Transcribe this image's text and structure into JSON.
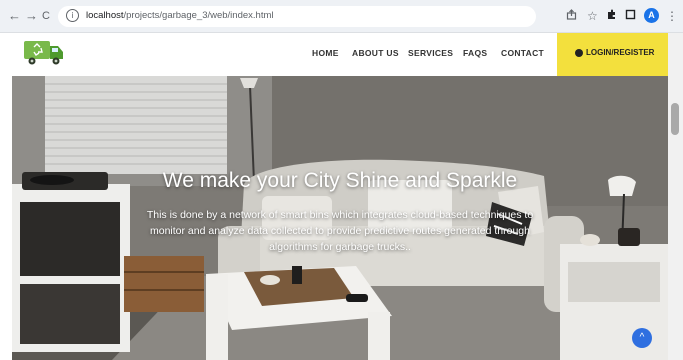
{
  "browser": {
    "url_host": "localhost",
    "url_path": "/projects/garbage_3/web/index.html",
    "back_glyph": "←",
    "forward_glyph": "→",
    "reload_glyph": "C",
    "profile_initial": "A",
    "profile_color": "#1a73e8"
  },
  "nav": {
    "items": [
      "HOME",
      "ABOUT US",
      "SERVICES",
      "FAQS",
      "CONTACT"
    ],
    "login_label": "LOGIN/REGISTER",
    "login_bg": "#f3e03d"
  },
  "hero": {
    "title": "We make your City Shine and Sparkle",
    "text": "This is done by a network of smart bins which integrates cloud-based techniques to monitor and analyze data collected to provide predictive routes generated through algorithms for garbage trucks.."
  },
  "back_to_top": {
    "glyph": "^",
    "color": "#2f6fe0"
  }
}
